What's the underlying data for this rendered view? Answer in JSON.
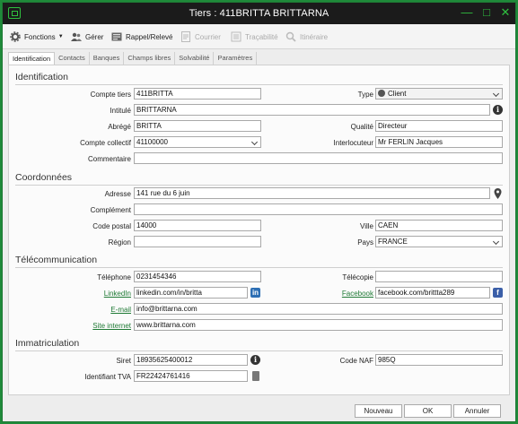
{
  "window": {
    "title": "Tiers : 411BRITTA BRITTARNA"
  },
  "toolbar": {
    "fonctions": "Fonctions",
    "gerer": "Gérer",
    "rappel": "Rappel/Relevé",
    "courrier": "Courrier",
    "tracabilite": "Traçabilité",
    "itineraire": "Itinéraire"
  },
  "tabs": [
    "Identification",
    "Contacts",
    "Banques",
    "Champs libres",
    "Solvabilité",
    "Paramètres"
  ],
  "identification": {
    "title": "Identification",
    "compte_tiers_label": "Compte tiers",
    "compte_tiers": "411BRITTA",
    "type_label": "Type",
    "type": "Client",
    "intitule_label": "Intitulé",
    "intitule": "BRITTARNA",
    "abrege_label": "Abrégé",
    "abrege": "BRITTA",
    "qualite_label": "Qualité",
    "qualite": "Directeur",
    "compte_collectif_label": "Compte collectif",
    "compte_collectif": "41100000",
    "interlocuteur_label": "Interlocuteur",
    "interlocuteur": "Mr FERLIN Jacques",
    "commentaire_label": "Commentaire",
    "commentaire": ""
  },
  "coordonnees": {
    "title": "Coordonnées",
    "adresse_label": "Adresse",
    "adresse": "141 rue du 6 juin",
    "complement_label": "Complément",
    "complement": "",
    "code_postal_label": "Code postal",
    "code_postal": "14000",
    "ville_label": "Ville",
    "ville": "CAEN",
    "region_label": "Région",
    "region": "",
    "pays_label": "Pays",
    "pays": "FRANCE"
  },
  "telecom": {
    "title": "Télécommunication",
    "telephone_label": "Téléphone",
    "telephone": "0231454346",
    "telecopie_label": "Télécopie",
    "telecopie": "",
    "linkedin_label": "LinkedIn",
    "linkedin": "linkedin.com/in/britta",
    "facebook_label": "Facebook",
    "facebook": "facebook.com/brittta289",
    "email_label": "E-mail",
    "email": "info@brittarna.com",
    "site_label": "Site internet",
    "site": "www.brittarna.com"
  },
  "immatriculation": {
    "title": "Immatriculation",
    "siret_label": "Siret",
    "siret": "18935625400012",
    "code_naf_label": "Code NAF",
    "code_naf": "985Q",
    "tva_label": "Identifiant TVA",
    "tva": "FR22424761416"
  },
  "buttons": {
    "nouveau": "Nouveau",
    "ok": "OK",
    "annuler": "Annuler"
  },
  "colors": {
    "accent": "#1f8a3a",
    "titlebar": "#1b1b1b",
    "link": "#1f7a35"
  }
}
